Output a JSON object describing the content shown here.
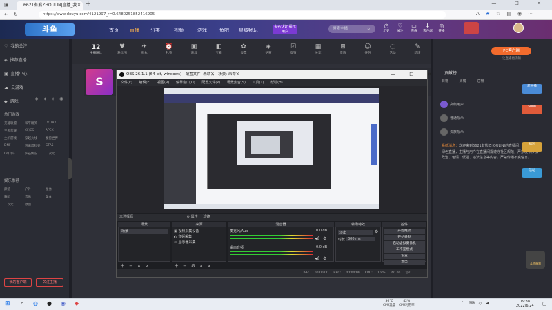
{
  "browser": {
    "tab_title": "6621有熊ZHOULINJ直播_我…",
    "url": "https://www.douyu.com/4121997_r=0.64802518524169​05",
    "window_controls": "— ☐ ✕"
  },
  "site": {
    "logo_text": "斗鱼",
    "nav": [
      "首页",
      "直播",
      "分类",
      "视频",
      "游戏",
      "鱼吧",
      "星域畅玩"
    ],
    "live_badge": "实名认证 提示用户",
    "search_placeholder": "搜索主播",
    "header_icons": [
      {
        "icon": "history-icon",
        "label": "历史"
      },
      {
        "icon": "follow-icon",
        "label": "关注"
      },
      {
        "icon": "purchase-icon",
        "label": "充值"
      },
      {
        "icon": "client-icon",
        "label": "客户端"
      },
      {
        "icon": "broadcast-icon",
        "label": "开播"
      }
    ]
  },
  "sidebar": {
    "items": [
      "我的关注",
      "推荐直播",
      "直播中心",
      "云游戏",
      "游戏"
    ],
    "hot_title": "热门游戏",
    "hot_games": [
      "英雄联盟",
      "和平精英",
      "DOTA2",
      "王者荣耀",
      "CF/CS",
      "APEX",
      "主机游戏",
      "穿越火线",
      "魔兽世界",
      "DNF",
      "逃离塔科夫",
      "GTA5",
      "QQ飞车",
      "炉石传说",
      "二次元"
    ],
    "rec_title": "娱乐推荐",
    "rec_items": [
      "颜值",
      "户外",
      "星秀",
      "舞蹈",
      "音乐",
      "美食",
      "二次元",
      "原创"
    ],
    "buttons": [
      "我的客户端",
      "关注主播"
    ]
  },
  "stream": {
    "fans_count": "12",
    "fans_label": "主播粉丝",
    "gifts": [
      "粉丝团",
      "鱼丸",
      "礼物",
      "道具",
      "宝箱",
      "饭票",
      "钻石",
      "竞猜",
      "分享",
      "贵族",
      "任务",
      "活动",
      "新增",
      "更多"
    ],
    "streamer_logo": "S"
  },
  "right_panel": {
    "pc_button": "PC客户端",
    "pc_sub": "让直播更流畅",
    "title": "贡献榜",
    "tabs": [
      "日榜",
      "周榜",
      "总榜"
    ],
    "ranks": [
      "高级用户",
      "普通观众",
      "贵族观众"
    ],
    "chat_user": "系统消息：",
    "chat_text": "欢迎来到6621有熊ZHOULINJ的直播间，斗鱼倡导绿色直播，主播与用户在直播间需遵守社区规范，严禁发布涉及政治、色情、低俗、违法信息等内容，严禁传播不良信息。",
    "promo": [
      "新主播",
      "5000",
      "福利",
      "活动"
    ],
    "mascot": "斗鱼福利"
  },
  "obs": {
    "title": "OBS 26.1.1 (64-bit, windows) - 配置文件: 未命名 - 场景: 未命名",
    "menu": [
      "文件(F)",
      "编辑(E)",
      "视图(V)",
      "停靠窗口(D)",
      "配置文件(P)",
      "场景集合(S)",
      "工具(T)",
      "帮助(H)"
    ],
    "ctrl_label": "未选择源",
    "ctrl_props": "⚙ 属性",
    "ctrl_filter": "滤镜",
    "docks": {
      "scenes": "场景",
      "sources": "来源",
      "mixer": "混音器",
      "transitions": "转场特效",
      "controls": "控件"
    },
    "scene_item": "场景",
    "sources": [
      "视频采集设备",
      "音频采集",
      "显示器采集"
    ],
    "mixer": [
      {
        "name": "麦克风/Aux",
        "db": "0.0 dB"
      },
      {
        "name": "桌面音频",
        "db": "0.0 dB"
      }
    ],
    "transition": "淡出",
    "duration_label": "时长",
    "duration": "300 ms",
    "control_buttons": [
      "开始推流",
      "开始录制",
      "启动虚拟摄像机",
      "工作室模式",
      "设置",
      "退出"
    ],
    "status": "LIVE: 00:00:00  REC: 00:00:00  CPU: 1.9%, 60.00 fps"
  },
  "taskbar": {
    "weather_temp": "36°C",
    "weather_label": "CPU温度",
    "cpu_pct": "42%",
    "cpu_label": "CPU利用率",
    "time": "19:38",
    "date": "2022/6/24"
  }
}
